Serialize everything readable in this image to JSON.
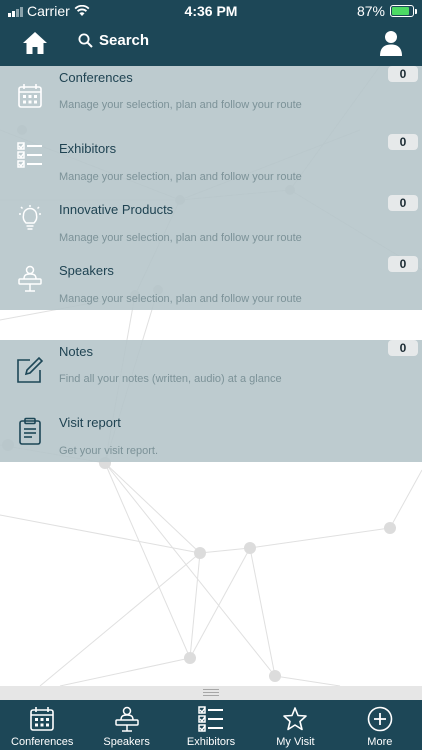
{
  "status_bar": {
    "carrier": "Carrier",
    "time": "4:36 PM",
    "battery": "87%",
    "battery_level": 0.87
  },
  "top_bar": {
    "search_label": "Search"
  },
  "panel_one": [
    {
      "title": "Conferences",
      "description": "Manage your selection, plan and follow your route",
      "count": "0",
      "icon": "calendar-icon"
    },
    {
      "title": "Exhibitors",
      "description": "Manage your selection, plan and follow your route",
      "count": "0",
      "icon": "checklist-icon"
    },
    {
      "title": "Innovative Products",
      "description": "Manage your selection, plan and follow your route",
      "count": "0",
      "icon": "lightbulb-icon"
    },
    {
      "title": "Speakers",
      "description": "Manage your selection, plan and follow your route",
      "count": "0",
      "icon": "speaker-icon"
    }
  ],
  "panel_two": [
    {
      "title": "Notes",
      "description": "Find all your notes (written, audio) at a glance",
      "count": "0",
      "icon": "note-edit-icon"
    },
    {
      "title": "Visit report",
      "description": "Get your visit report.",
      "icon": "clipboard-icon"
    }
  ],
  "tab_bar": [
    {
      "label": "Conferences",
      "icon": "calendar-icon"
    },
    {
      "label": "Speakers",
      "icon": "speaker-icon"
    },
    {
      "label": "Exhibitors",
      "icon": "checklist-icon"
    },
    {
      "label": "My Visit",
      "icon": "star-icon"
    },
    {
      "label": "More",
      "icon": "plus-circle-icon"
    }
  ],
  "colors": {
    "header": "#1d4757",
    "panel": "#b4c4c8",
    "title_text": "#1f4352",
    "battery": "#4cd964"
  }
}
